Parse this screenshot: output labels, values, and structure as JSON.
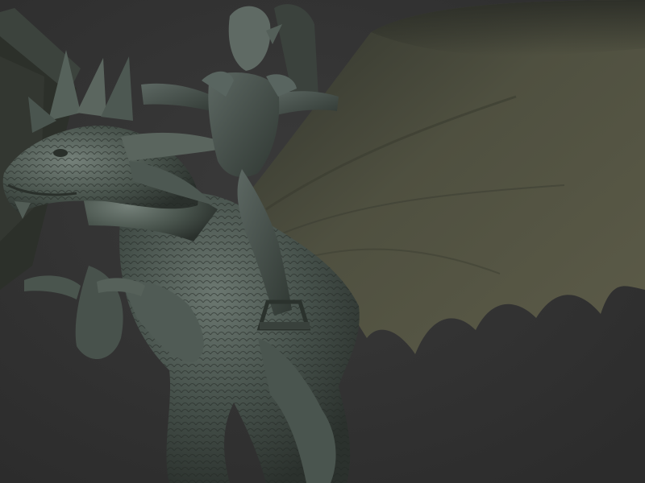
{
  "scene": {
    "background_color": "#333333",
    "material_colors": {
      "wing_membrane": "#4f5040",
      "wing_shadow": "#2a2c26",
      "skin_dark": "#2f3632",
      "skin_mid": "#46514b",
      "skin_light": "#6b7770",
      "rider": "#3e4742"
    },
    "subjects": [
      {
        "name": "dragon",
        "icon": "dragon-sculpt"
      },
      {
        "name": "rider",
        "icon": "goblin-rider-sculpt"
      }
    ]
  }
}
